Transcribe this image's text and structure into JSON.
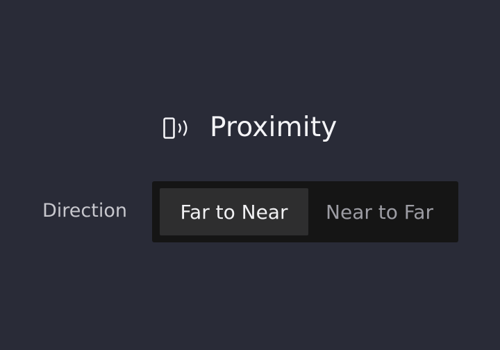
{
  "header": {
    "icon": "phone-proximity-icon",
    "title": "Proximity"
  },
  "direction": {
    "label": "Direction",
    "options": [
      "Far to Near",
      "Near to Far"
    ],
    "selected": "Far to Near"
  },
  "colors": {
    "background": "#292b37",
    "control_background": "#151515",
    "selected_segment": "#2e2e2f",
    "text_primary": "#f4f4f7",
    "text_secondary": "#9d9da4"
  }
}
